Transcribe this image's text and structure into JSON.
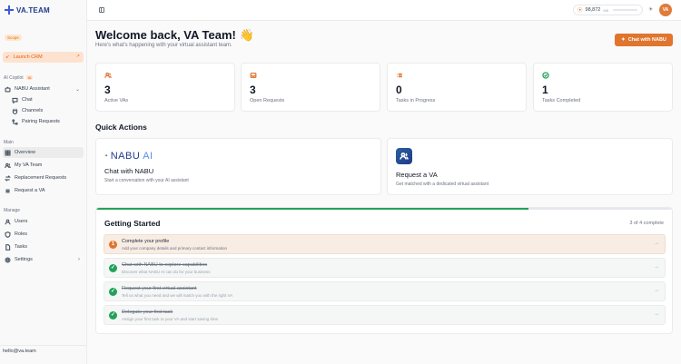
{
  "sidebar": {
    "logo_text": "VA.TEAM",
    "scope_badge": "Scope",
    "launch_label": "Launch CRM",
    "ai_copilot_label": "AI Copilot",
    "ai_tag": "AI",
    "nabu_assistant": "NABU Assistant",
    "nabu_sub": [
      "Chat",
      "Channels",
      "Pairing Requests"
    ],
    "main_label": "Main",
    "main_items": [
      "Overview",
      "My VA Team",
      "Replacement Requests",
      "Request a VA"
    ],
    "manage_label": "Manage",
    "manage_items": [
      "Users",
      "Roles",
      "Tasks",
      "Settings"
    ],
    "email": "hello@va.team"
  },
  "topbar": {
    "credits": "98,872",
    "credits_pct": "9/8",
    "avatar_initials": "VA"
  },
  "header": {
    "title": "Welcome back, VA Team! 👋",
    "subtitle": "Here's what's happening with your virtual assistant team.",
    "chat_button": "Chat with NABU"
  },
  "stats": [
    {
      "value": "3",
      "label": "Active VAs",
      "icon": "users-icon"
    },
    {
      "value": "3",
      "label": "Open Requests",
      "icon": "inbox-icon"
    },
    {
      "value": "0",
      "label": "Tasks in Progress",
      "icon": "list-icon"
    },
    {
      "value": "1",
      "label": "Tasks Completed",
      "icon": "check-circle-icon"
    }
  ],
  "quick_actions": {
    "title": "Quick Actions",
    "nabu_logo": "NABU",
    "nabu_logo_ai": "AI",
    "chat_title": "Chat with NABU",
    "chat_desc": "Start a conversation with your AI assistant",
    "va_title": "Request a VA",
    "va_desc": "Get matched with a dedicated virtual assistant"
  },
  "getting_started": {
    "title": "Getting Started",
    "count": "3 of 4 complete",
    "progress": 0.75,
    "tasks": [
      {
        "marker": "1",
        "title": "Complete your profile",
        "desc": "Add your company details and primary contact information",
        "done": false
      },
      {
        "marker": "✓",
        "title": "Chat with NABU to explore capabilities",
        "desc": "Discover what NABU AI can do for your business",
        "done": true
      },
      {
        "marker": "✓",
        "title": "Request your first virtual assistant",
        "desc": "Tell us what you need and we will match you with the right VA",
        "done": true
      },
      {
        "marker": "✓",
        "title": "Delegate your first task",
        "desc": "Assign your first task to your VA and start saving time",
        "done": true
      }
    ]
  },
  "colors": {
    "accent": "#e0752e",
    "success": "#22a25a",
    "brand": "#1e3a8a"
  }
}
